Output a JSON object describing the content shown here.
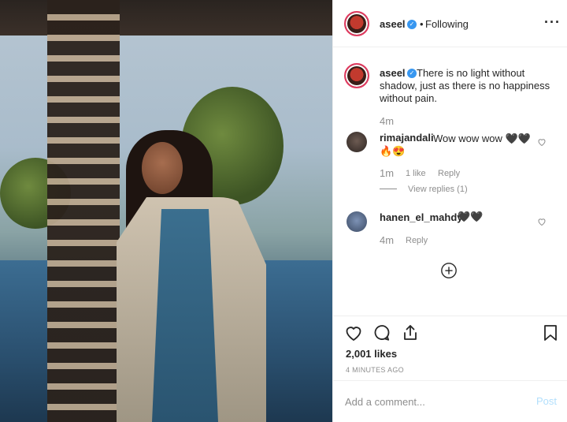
{
  "post": {
    "author": "aseel",
    "follow_status": "Following",
    "separator": "•",
    "more_icon": "more-horizontal-icon",
    "caption": "There is no light without shadow, just as there is no happiness without pain.",
    "caption_time": "4m"
  },
  "comments": [
    {
      "username": "rimajandali",
      "text": "Wow wow wow 🖤🖤",
      "emoji_line": "🔥😍",
      "time": "1m",
      "likes": "1 like",
      "reply_label": "Reply",
      "view_replies": "View replies (1)"
    },
    {
      "username": "hanen_el_mahdy",
      "text": "🖤🖤",
      "time": "4m",
      "reply_label": "Reply"
    }
  ],
  "stats": {
    "likes": "2,001 likes",
    "time_ago": "4 MINUTES AGO"
  },
  "comment_box": {
    "placeholder": "Add a comment...",
    "post_label": "Post"
  },
  "colors": {
    "verified": "#3897f0",
    "text": "#262626",
    "muted": "#8e8e8e",
    "post_disabled": "#b2dffc",
    "story_ring": "#e03a5f"
  }
}
